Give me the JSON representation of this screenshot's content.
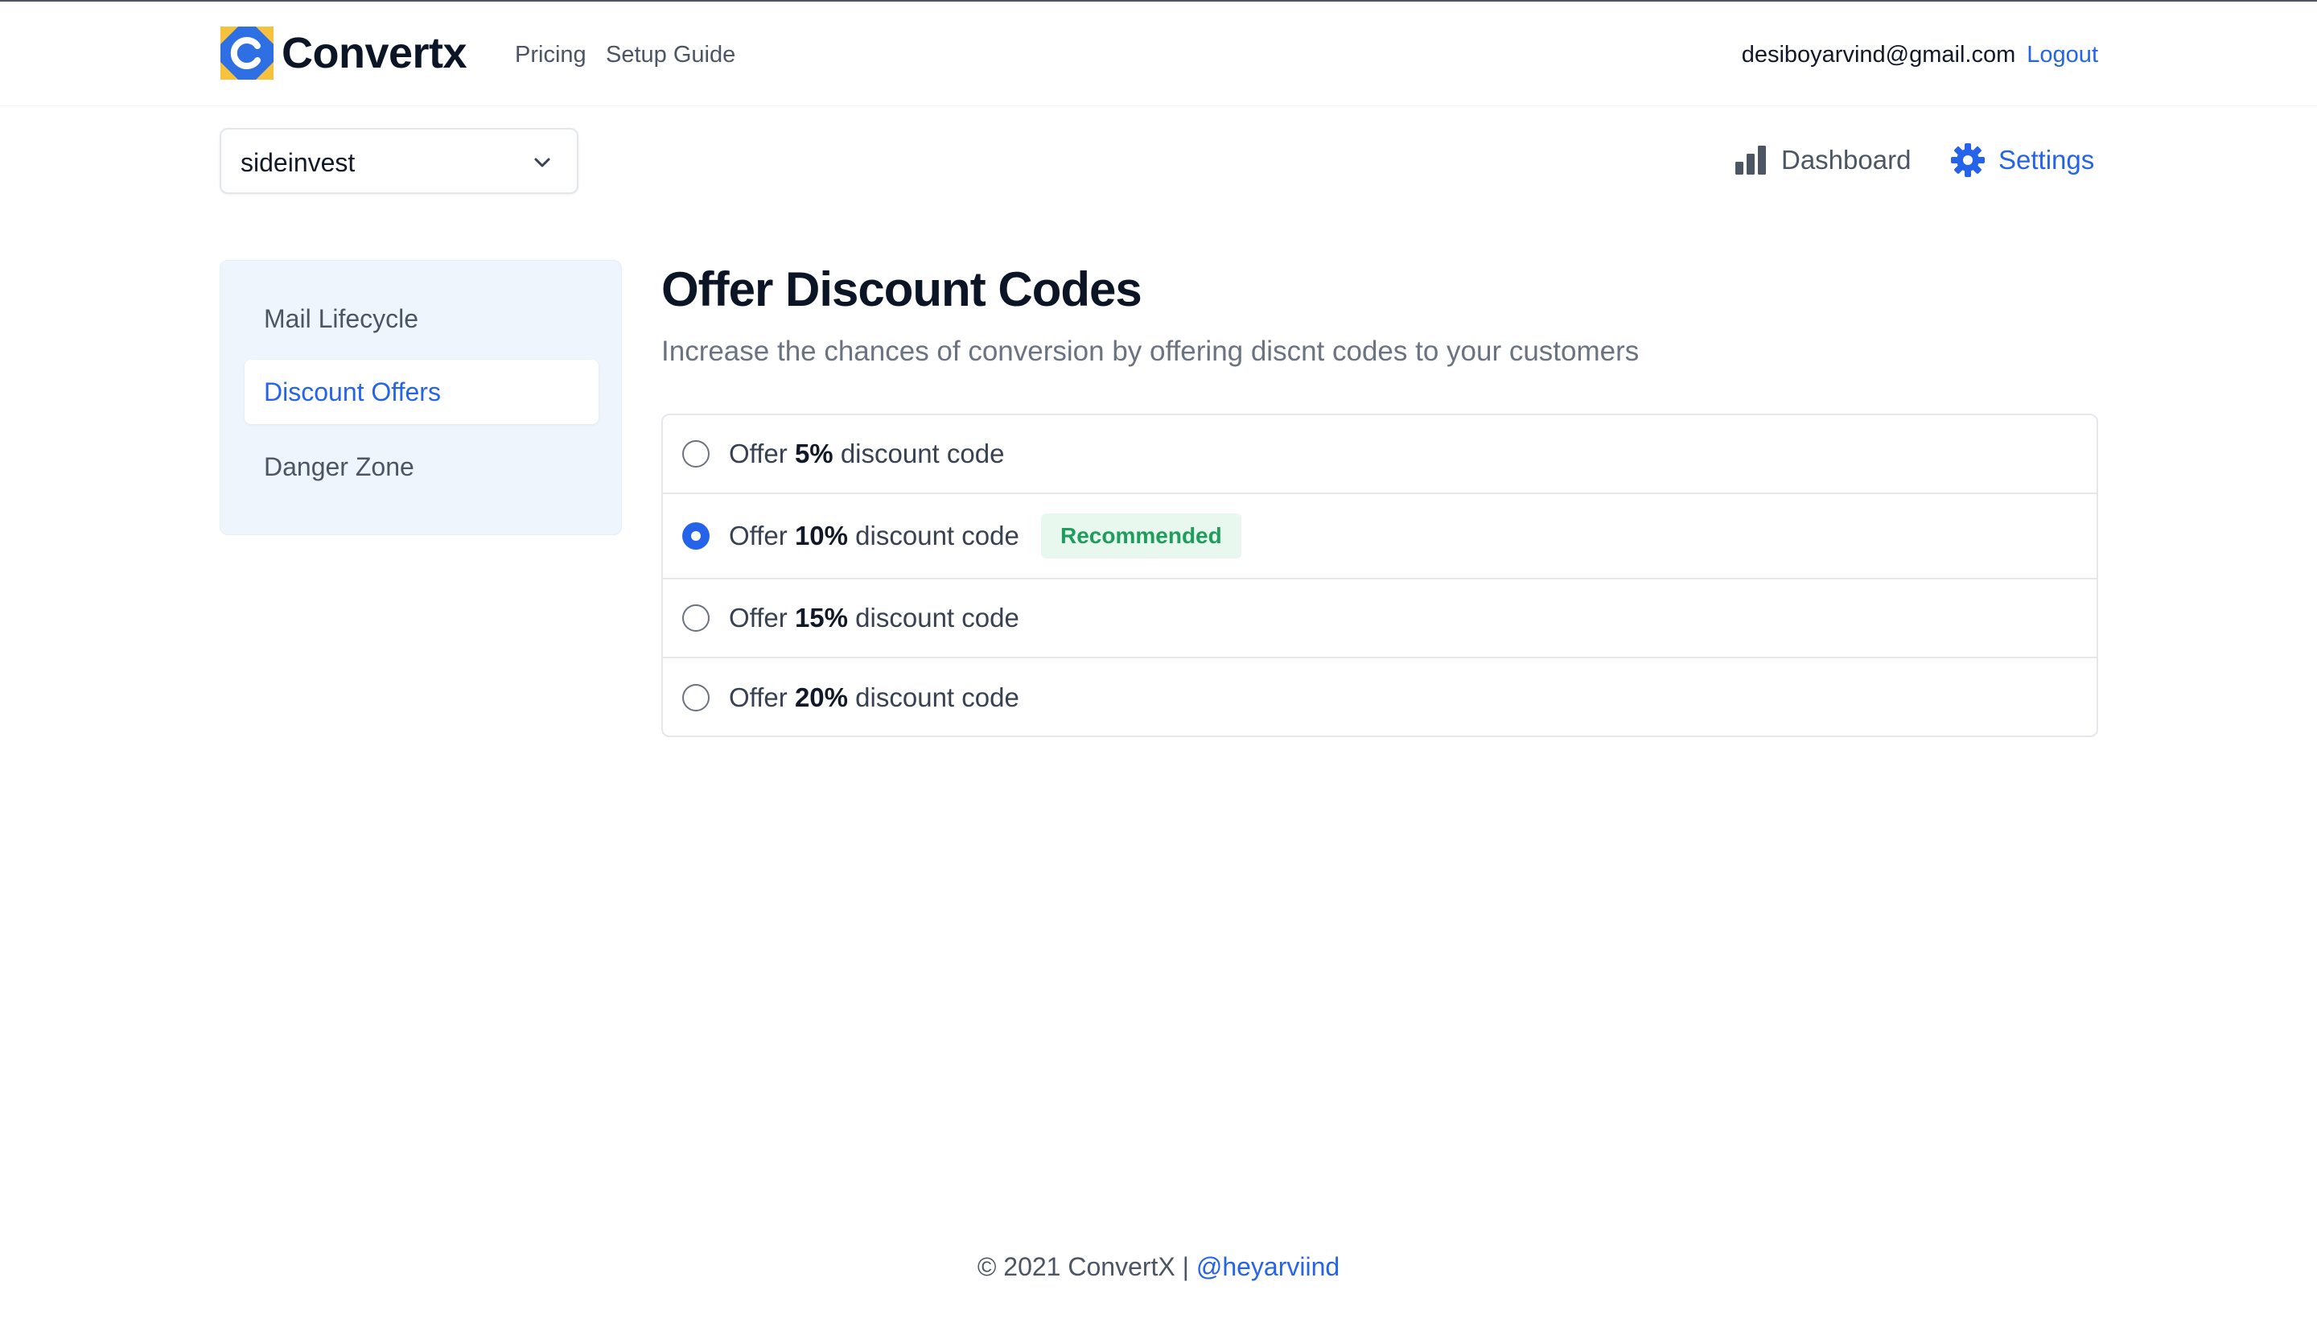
{
  "header": {
    "brand": "Convertx",
    "nav": {
      "pricing": "Pricing",
      "setup_guide": "Setup Guide"
    },
    "user_email": "desiboyarvind@gmail.com",
    "logout": "Logout"
  },
  "project_select": {
    "value": "sideinvest"
  },
  "tabs": {
    "dashboard": "Dashboard",
    "settings": "Settings",
    "active": "settings"
  },
  "sidebar": {
    "items": [
      {
        "label": "Mail Lifecycle"
      },
      {
        "label": "Discount Offers"
      },
      {
        "label": "Danger Zone"
      }
    ],
    "active": "Discount Offers"
  },
  "main": {
    "title": "Offer Discount Codes",
    "subtitle": "Increase the chances of conversion by offering discnt codes to your customers",
    "options": [
      {
        "prefix": "Offer",
        "value": "5%",
        "suffix": "discount code",
        "checked": false
      },
      {
        "prefix": "Offer",
        "value": "10%",
        "suffix": "discount code",
        "checked": true,
        "badge": "Recommended"
      },
      {
        "prefix": "Offer",
        "value": "15%",
        "suffix": "discount code",
        "checked": false
      },
      {
        "prefix": "Offer",
        "value": "20%",
        "suffix": "discount code",
        "checked": false
      }
    ]
  },
  "footer": {
    "text": "© 2021 ConvertX | ",
    "handle": "@heyarviind"
  },
  "colors": {
    "accent": "#2563eb",
    "badge_bg": "#e8f8ef",
    "badge_text": "#1f9d5c",
    "sidebar_bg": "#eef5fd"
  },
  "icons": {
    "logo": "convertx-logo-icon",
    "select_chevron": "chevron-down-icon",
    "dashboard": "bar-chart-icon",
    "settings": "gear-icon"
  }
}
